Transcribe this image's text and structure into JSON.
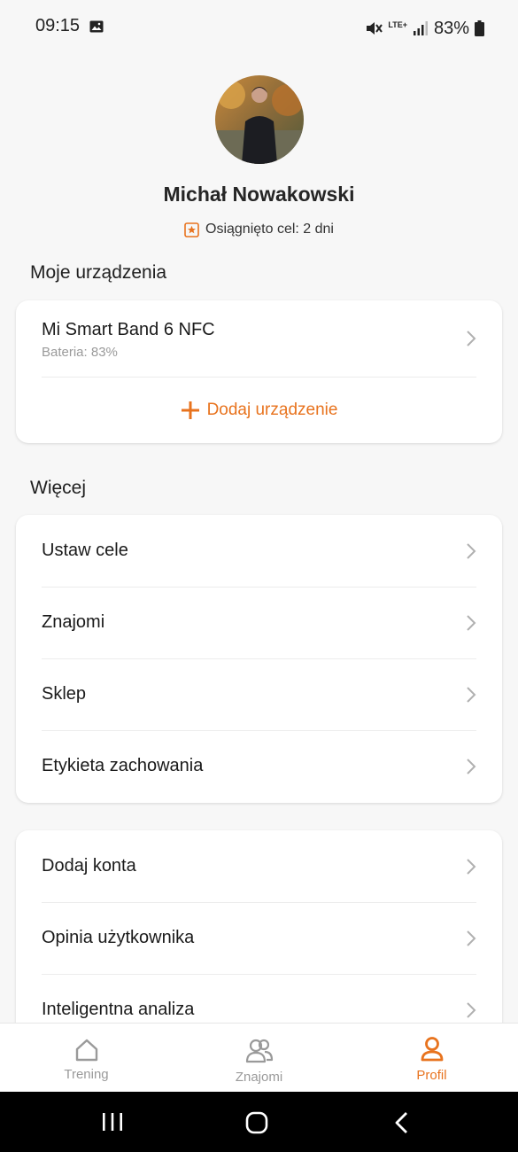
{
  "status_bar": {
    "time": "09:15",
    "network": "LTE+",
    "battery": "83%"
  },
  "profile": {
    "name": "Michał Nowakowski",
    "goal_text": "Osiągnięto cel: 2 dni"
  },
  "devices_section": {
    "title": "Moje urządzenia",
    "device_name": "Mi Smart Band 6 NFC",
    "device_battery": "Bateria: 83%",
    "add_device_label": "Dodaj urządzenie"
  },
  "more_section": {
    "title": "Więcej",
    "items": [
      {
        "label": "Ustaw cele"
      },
      {
        "label": "Znajomi"
      },
      {
        "label": "Sklep"
      },
      {
        "label": "Etykieta zachowania"
      }
    ]
  },
  "extra_section": {
    "items": [
      {
        "label": "Dodaj konta"
      },
      {
        "label": "Opinia użytkownika"
      },
      {
        "label": "Inteligentna analiza"
      }
    ]
  },
  "bottom_nav": {
    "items": [
      {
        "label": "Trening",
        "icon": "home-icon",
        "active": false
      },
      {
        "label": "Znajomi",
        "icon": "friends-icon",
        "active": false
      },
      {
        "label": "Profil",
        "icon": "profile-icon",
        "active": true
      }
    ]
  },
  "colors": {
    "accent": "#e8731e",
    "background": "#f7f7f7",
    "card": "#ffffff"
  }
}
